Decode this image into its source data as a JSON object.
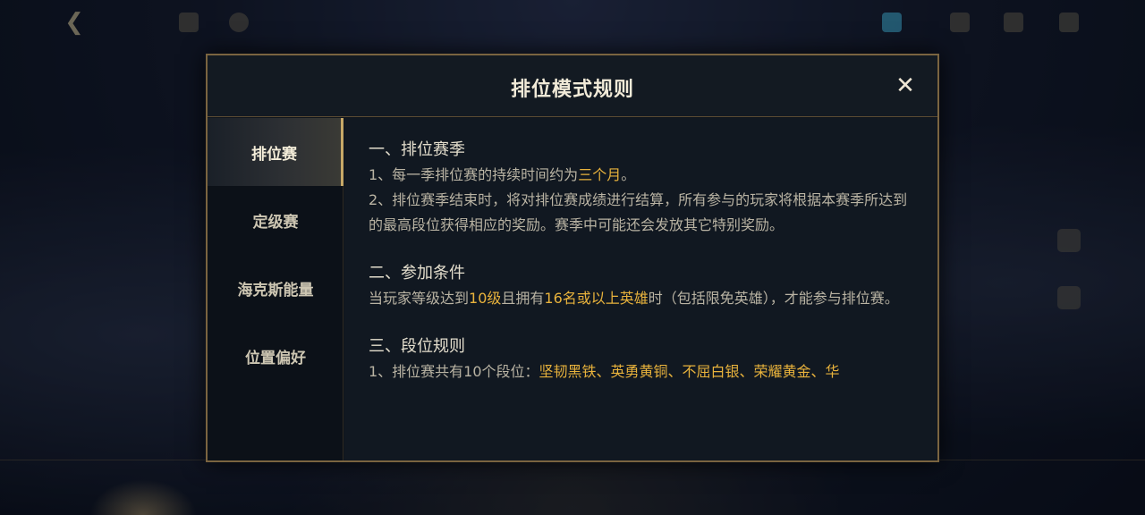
{
  "dialog": {
    "title": "排位模式规则",
    "close_glyph": "✕"
  },
  "sidebar": {
    "items": [
      {
        "label": "排位赛",
        "active": true
      },
      {
        "label": "定级赛",
        "active": false
      },
      {
        "label": "海克斯能量",
        "active": false
      },
      {
        "label": "位置偏好",
        "active": false
      }
    ]
  },
  "content": {
    "s1_title": "一、排位赛季",
    "s1_p1_a": "1、每一季排位赛的持续时间约为",
    "s1_p1_hl": "三个月",
    "s1_p1_b": "。",
    "s1_p2": "2、排位赛季结束时，将对排位赛成绩进行结算，所有参与的玩家将根据本赛季所达到的最高段位获得相应的奖励。赛季中可能还会发放其它特别奖励。",
    "s2_title": "二、参加条件",
    "s2_p_a": "当玩家等级达到",
    "s2_p_hl1": "10级",
    "s2_p_b": "且拥有",
    "s2_p_hl2": "16名或以上英雄",
    "s2_p_c": "时（包括限免英雄），才能参与排位赛。",
    "s3_title": "三、段位规则",
    "s3_p_a": "1、排位赛共有10个段位：",
    "s3_p_hl": "坚韧黑铁、英勇黄铜、不屈白银、荣耀黄金、华"
  },
  "colors": {
    "highlight": "#e8b23c",
    "border": "#7a6440",
    "active_tab_bar": "#c7a867"
  },
  "icons": {
    "back": "back-arrow-icon",
    "close": "close-icon"
  }
}
